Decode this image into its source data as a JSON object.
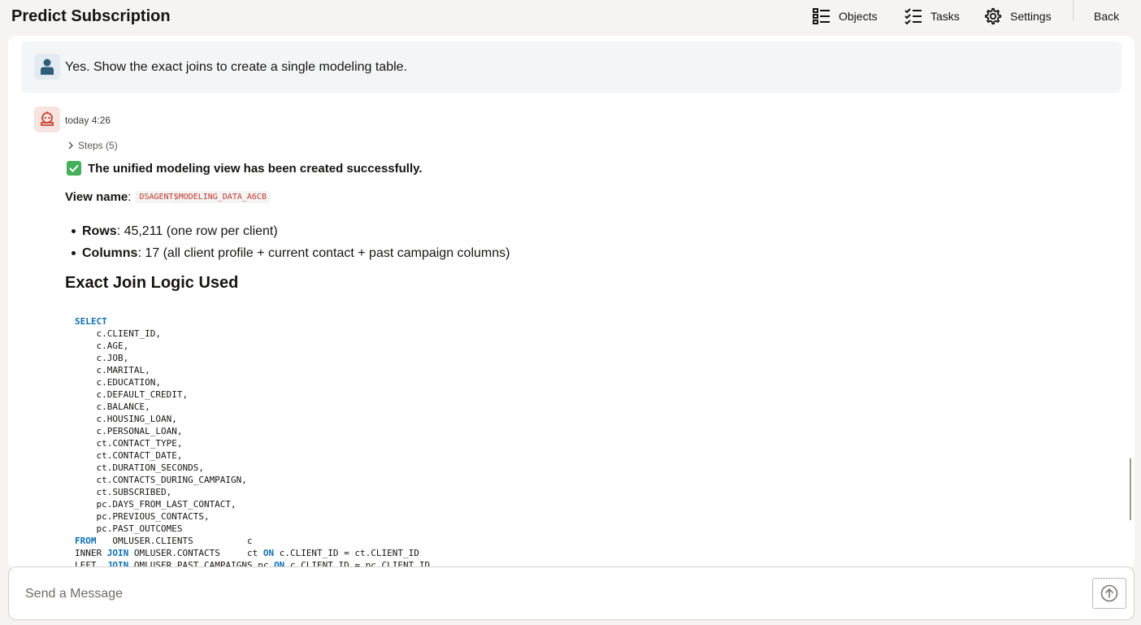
{
  "app": {
    "title": "Predict Subscription"
  },
  "nav": {
    "objects": "Objects",
    "tasks": "Tasks",
    "settings": "Settings",
    "back": "Back"
  },
  "user_message": {
    "text": "Yes. Show the exact joins to create a single modeling table."
  },
  "assistant": {
    "timestamp": "today 4:26",
    "steps_label": "Steps (5)",
    "success_text": "The unified modeling view has been created successfully.",
    "view_label": "View name",
    "view_sep": ":",
    "view_name": "DSAGENT$MODELING_DATA_A6CB",
    "bullets": [
      {
        "label": "Rows",
        "text": ": 45,211 (one row per client)"
      },
      {
        "label": "Columns",
        "text": ": 17 (all client profile + current contact + past campaign columns)"
      }
    ],
    "heading": "Exact Join Logic Used",
    "code": {
      "select_kw": "SELECT",
      "columns": [
        "    c.CLIENT_ID,",
        "    c.AGE,",
        "    c.JOB,",
        "    c.MARITAL,",
        "    c.EDUCATION,",
        "    c.DEFAULT_CREDIT,",
        "    c.BALANCE,",
        "    c.HOUSING_LOAN,",
        "    c.PERSONAL_LOAN,",
        "    ct.CONTACT_TYPE,",
        "    ct.CONTACT_DATE,",
        "    ct.DURATION_SECONDS,",
        "    ct.CONTACTS_DURING_CAMPAIGN,",
        "    ct.SUBSCRIBED,",
        "    pc.DAYS_FROM_LAST_CONTACT,",
        "    pc.PREVIOUS_CONTACTS,",
        "    pc.PAST_OUTCOMES"
      ],
      "from_kw": "FROM",
      "from_rest": "   OMLUSER.CLIENTS          c",
      "inner_pre": "INNER ",
      "join_kw": "JOIN",
      "inner_table": " OMLUSER.CONTACTS     ct ",
      "on_kw": "ON",
      "inner_cond": " c.CLIENT_ID = ct.CLIENT_ID",
      "left_pre": "LEFT  ",
      "left_table": " OMLUSER.PAST_CAMPAIGNS pc ",
      "left_cond": " c.CLIENT_ID = pc.CLIENT_ID"
    }
  },
  "composer": {
    "placeholder": "Send a Message"
  },
  "colors": {
    "background": "#f5f4f2",
    "keyword": "#0f6fb4",
    "inline_code": "#c0392b",
    "success_check": "#44b05a"
  },
  "icons": {
    "objects": "list-icon",
    "tasks": "checklist-icon",
    "settings": "gear-icon",
    "user": "person-icon",
    "assistant": "robot-icon",
    "steps": "chevron-right-icon",
    "success": "check-icon",
    "send": "arrow-up-circle-icon"
  }
}
